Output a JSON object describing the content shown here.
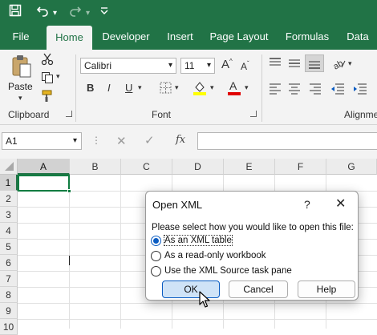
{
  "quick_access": {
    "save_icon": "save-icon",
    "undo_icon": "undo-icon",
    "redo_icon": "redo-icon",
    "customize_icon": "chevron-down-icon"
  },
  "tabs": [
    {
      "label": "File"
    },
    {
      "label": "Home"
    },
    {
      "label": "Developer"
    },
    {
      "label": "Insert"
    },
    {
      "label": "Page Layout"
    },
    {
      "label": "Formulas"
    },
    {
      "label": "Data"
    }
  ],
  "active_tab": "Home",
  "colors": {
    "brand": "#217346",
    "active_cell": "#107c41",
    "accent": "#0a5cc2"
  },
  "ribbon": {
    "clipboard": {
      "group_label": "Clipboard",
      "paste_label": "Paste"
    },
    "font": {
      "group_label": "Font",
      "font_name": "Calibri",
      "font_size": "11"
    },
    "alignment": {
      "group_label": "Alignme"
    }
  },
  "formula_bar": {
    "name_box": "A1",
    "fx_label": "fx",
    "formula": ""
  },
  "grid": {
    "columns": [
      "A",
      "B",
      "C",
      "D",
      "E",
      "F",
      "G"
    ],
    "rows": [
      "1",
      "2",
      "3",
      "4",
      "5",
      "6",
      "7",
      "8",
      "9",
      "10"
    ],
    "active_cell": "A1"
  },
  "dialog": {
    "title": "Open XML",
    "help_glyph": "?",
    "close_glyph": "✕",
    "prompt": "Please select how you would like to open this file:",
    "options": [
      {
        "label": "As an XML table",
        "selected": true
      },
      {
        "label": "As a read-only workbook",
        "selected": false
      },
      {
        "label": "Use the XML Source task pane",
        "selected": false
      }
    ],
    "ok_label": "OK",
    "cancel_label": "Cancel",
    "help_label": "Help"
  }
}
